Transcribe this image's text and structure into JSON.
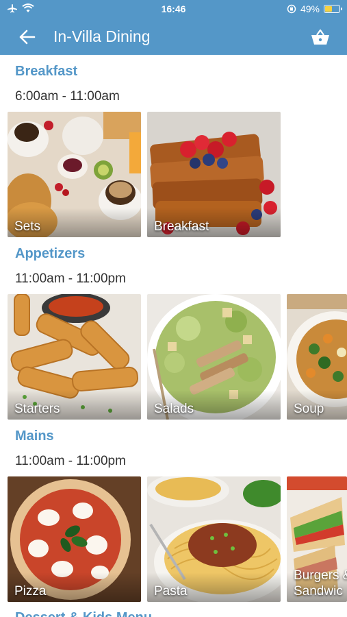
{
  "status_bar": {
    "time": "16:46",
    "battery": "49%",
    "battery_level": 0.49
  },
  "app_bar": {
    "title": "In-Villa Dining"
  },
  "sections": [
    {
      "title": "Breakfast",
      "hours": "6:00am - 11:00am",
      "items": [
        {
          "label": "Sets"
        },
        {
          "label": "Breakfast"
        }
      ]
    },
    {
      "title": "Appetizers",
      "hours": "11:00am - 11:00pm",
      "items": [
        {
          "label": "Starters"
        },
        {
          "label": "Salads"
        },
        {
          "label": "Soup"
        }
      ]
    },
    {
      "title": "Mains",
      "hours": "11:00am - 11:00pm",
      "items": [
        {
          "label": "Pizza"
        },
        {
          "label": "Pasta"
        },
        {
          "label": "Burgers & Sandwiches",
          "label_line1": "Burgers &",
          "label_line2": "Sandwic"
        }
      ]
    },
    {
      "title": "Dessert & Kids Menu"
    }
  ],
  "colors": {
    "header": "#5497c8",
    "section_title": "#5497c8",
    "hours_text": "#333333"
  }
}
